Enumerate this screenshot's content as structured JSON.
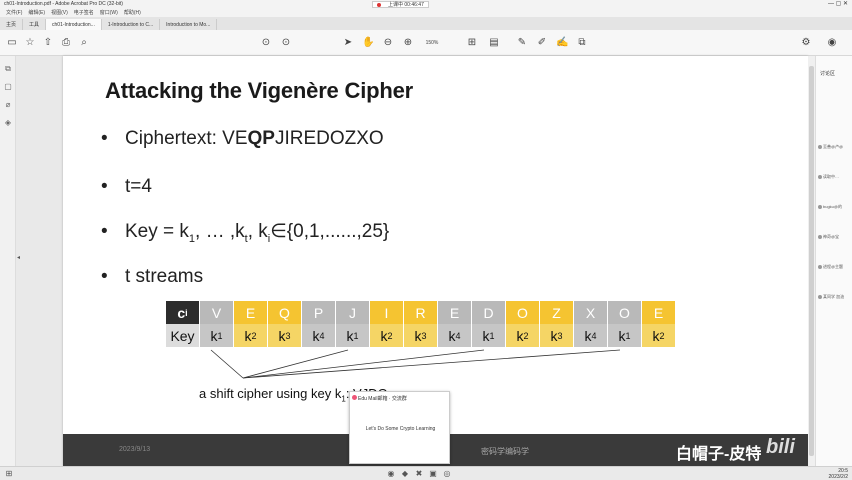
{
  "window": {
    "title": "ch01-Introduction.pdf - Adobe Acrobat Pro DC (32-bit)",
    "menu": [
      "文件(F)",
      "编辑(E)",
      "视图(V)",
      "电子签名",
      "窗口(W)",
      "帮助(H)"
    ],
    "recording": "上课中 00:46:47"
  },
  "tabs": [
    {
      "label": "主页"
    },
    {
      "label": "工具"
    },
    {
      "label": "ch01-Introduction..."
    },
    {
      "label": "1-Introduction to C..."
    },
    {
      "label": "Introduction to Mo..."
    }
  ],
  "toolbar": {
    "zoom": "150%"
  },
  "slide": {
    "title": "Attacking the Vigenère Cipher",
    "bullet_ciphertext_label": "Ciphertext: ",
    "bullet_ciphertext_pre": "VE",
    "bullet_ciphertext_bold": "QP",
    "bullet_ciphertext_post": "JIREDOZXO",
    "bullet_t": "t=4",
    "bullet_key_a": "Key = k",
    "bullet_key_sub1": "1",
    "bullet_key_b": ", … ,k",
    "bullet_key_subt": "t",
    "bullet_key_c": ", k",
    "bullet_key_subi": "i",
    "bullet_key_d": "∈{0,1,......,25}",
    "bullet_streams": "t streams",
    "row1_head": "c",
    "row1_head_sub": "i",
    "row1": [
      "V",
      "E",
      "Q",
      "P",
      "J",
      "I",
      "R",
      "E",
      "D",
      "O",
      "Z",
      "X",
      "O",
      "E"
    ],
    "row2_head": "Key",
    "row2": [
      {
        "k": "k",
        "s": "1"
      },
      {
        "k": "k",
        "s": "2"
      },
      {
        "k": "k",
        "s": "3"
      },
      {
        "k": "k",
        "s": "4"
      },
      {
        "k": "k",
        "s": "1"
      },
      {
        "k": "k",
        "s": "2"
      },
      {
        "k": "k",
        "s": "3"
      },
      {
        "k": "k",
        "s": "4"
      },
      {
        "k": "k",
        "s": "1"
      },
      {
        "k": "k",
        "s": "2"
      },
      {
        "k": "k",
        "s": "3"
      },
      {
        "k": "k",
        "s": "4"
      },
      {
        "k": "k",
        "s": "1"
      },
      {
        "k": "k",
        "s": "2"
      }
    ],
    "annotation_a": "a shift cipher using key k",
    "annotation_sub": "1",
    "annotation_b": ": VJDO",
    "footer_date": "2023/9/13",
    "footer_right": "密码学编码学",
    "watermark": "白帽子-皮特"
  },
  "popup": {
    "header": "Edu Mail邮箱 · 交流群",
    "body": "Let's Do Some Crypto Learning"
  },
  "rightpanel": {
    "title": "讨论区",
    "items": [
      "至善@卢@",
      "读取中…",
      "bugku@的",
      "神奇@宝",
      "进程@主题",
      "某同学 加油"
    ]
  },
  "clock": {
    "time": "20:5",
    "date": "2023/2/2"
  },
  "colors": {
    "cipher_yellow": "#f5c431",
    "cipher_gray": "#b9b9b9",
    "header_dark": "#2c2c2c"
  }
}
